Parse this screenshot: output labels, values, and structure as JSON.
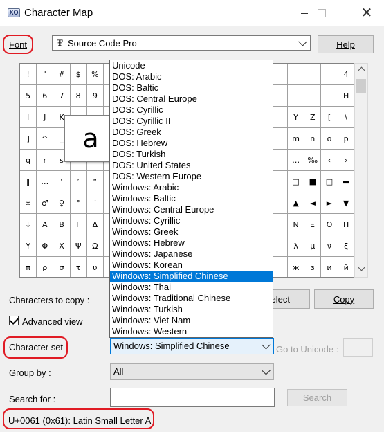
{
  "window": {
    "title": "Character Map",
    "app_icon_text": "ΧΘ"
  },
  "font": {
    "label": "Font",
    "value": "Source Code Pro",
    "font_icon": "TrueType-icon"
  },
  "help_button": "Help",
  "grid_rows": [
    [
      "!",
      "\"",
      "#",
      "$",
      "%",
      "",
      "",
      "",
      "",
      "",
      "",
      "",
      "",
      "",
      "",
      "",
      "",
      "",
      "",
      "4"
    ],
    [
      "5",
      "6",
      "7",
      "8",
      "9",
      "",
      "",
      "",
      "",
      "",
      "",
      "",
      "",
      "",
      "",
      "",
      "",
      "",
      "",
      "H"
    ],
    [
      "I",
      "J",
      "K",
      "",
      "",
      "",
      "",
      "",
      "",
      "",
      "",
      "",
      "",
      "",
      "",
      "",
      "Y",
      "Z",
      "[",
      "\\"
    ],
    [
      "]",
      "^",
      "_",
      "",
      "",
      "",
      "",
      "",
      "",
      "",
      "",
      "",
      "",
      "",
      "",
      "",
      "m",
      "n",
      "o",
      "p"
    ],
    [
      "q",
      "r",
      "s",
      "",
      "",
      "",
      "",
      "",
      "",
      "",
      "",
      "",
      "",
      "",
      "",
      "",
      "…",
      "‰",
      "‹",
      "›"
    ],
    [
      "‖",
      "…",
      "‘",
      "’",
      "“",
      "",
      "",
      "",
      "",
      "",
      "",
      "",
      "",
      "",
      "",
      "",
      "□",
      "■",
      "□",
      "▬"
    ],
    [
      "∞",
      "♂",
      "♀",
      "°",
      "′",
      "",
      "",
      "",
      "",
      "",
      "",
      "",
      "",
      "",
      "",
      "",
      "▲",
      "◄",
      "►",
      "▼"
    ],
    [
      "↓",
      "Α",
      "Β",
      "Γ",
      "Δ",
      "",
      "",
      "",
      "",
      "",
      "",
      "",
      "",
      "",
      "",
      "",
      "Ν",
      "Ξ",
      "Ο",
      "Π"
    ],
    [
      "Υ",
      "Φ",
      "Χ",
      "Ψ",
      "Ω",
      "",
      "",
      "",
      "",
      "",
      "",
      "",
      "",
      "",
      "",
      "",
      "λ",
      "μ",
      "ν",
      "ξ"
    ],
    [
      "π",
      "ρ",
      "σ",
      "τ",
      "υ",
      "",
      "",
      "",
      "",
      "",
      "",
      "",
      "",
      "",
      "",
      "",
      "ж",
      "з",
      "и",
      "й"
    ]
  ],
  "zoom_char": "a",
  "dropdown_options": [
    "Unicode",
    "DOS: Arabic",
    "DOS: Baltic",
    "DOS: Central Europe",
    "DOS: Cyrillic",
    "DOS: Cyrillic II",
    "DOS: Greek",
    "DOS: Hebrew",
    "DOS: Turkish",
    "DOS: United States",
    "DOS: Western Europe",
    "Windows: Arabic",
    "Windows: Baltic",
    "Windows: Central Europe",
    "Windows: Cyrillic",
    "Windows: Greek",
    "Windows: Hebrew",
    "Windows: Japanese",
    "Windows: Korean",
    "Windows: Simplified Chinese",
    "Windows: Thai",
    "Windows: Traditional Chinese",
    "Windows: Turkish",
    "Windows: Viet Nam",
    "Windows: Western"
  ],
  "dropdown_selected_index": 19,
  "copy": {
    "label": "Characters to copy :",
    "value": "",
    "select_button": "Select",
    "select_button_visible": "elect",
    "copy_button": "Copy"
  },
  "advanced_view": {
    "label": "Advanced view",
    "checked": true
  },
  "character_set": {
    "label": "Character set",
    "value": "Windows: Simplified Chinese"
  },
  "go_to_unicode": {
    "label": "Go to Unicode :",
    "value": ""
  },
  "group_by": {
    "label": "Group by :",
    "value": "All"
  },
  "search": {
    "label": "Search for :",
    "value": "",
    "button": "Search"
  },
  "status": "U+0061 (0x61): Latin Small Letter A",
  "colors": {
    "highlight": "#e01b24",
    "selection": "#0078d7"
  }
}
